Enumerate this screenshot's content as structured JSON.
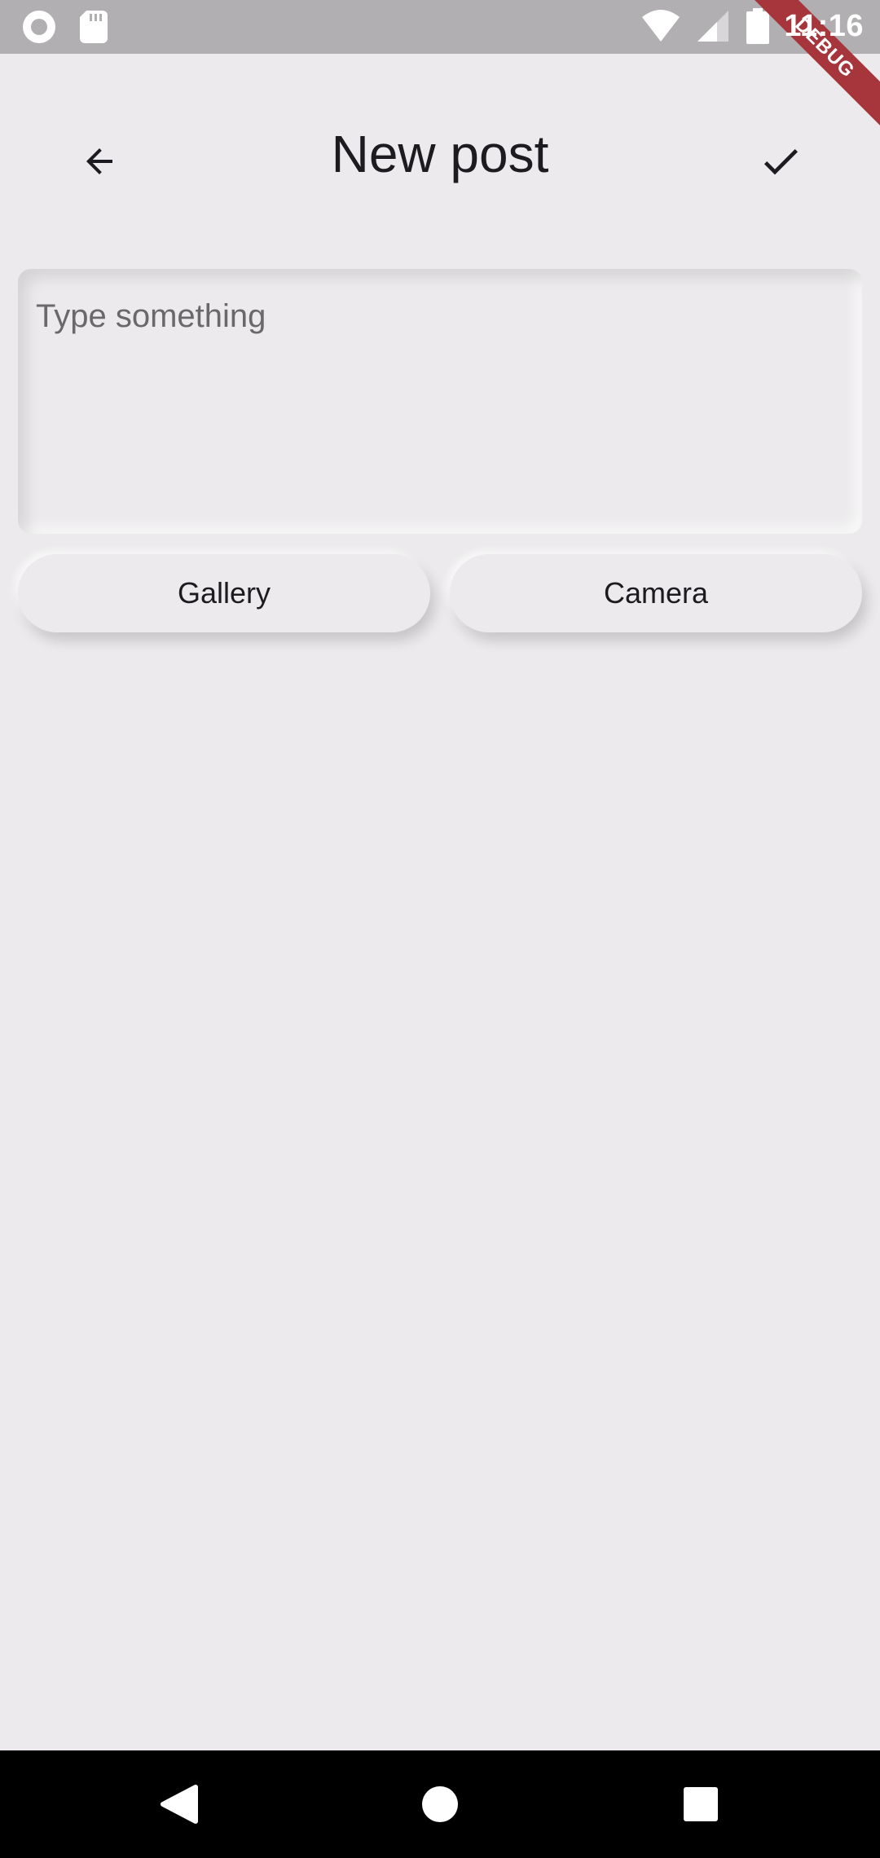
{
  "status_bar": {
    "time": "11:16",
    "icons": [
      "record-icon",
      "sd-card-icon",
      "wifi-icon",
      "signal-icon",
      "battery-icon"
    ],
    "debug_label": "DEBUG"
  },
  "app_bar": {
    "title": "New post",
    "back_icon": "arrow-back-icon",
    "confirm_icon": "check-icon"
  },
  "composer": {
    "placeholder": "Type something",
    "value": ""
  },
  "actions": {
    "gallery_label": "Gallery",
    "camera_label": "Camera"
  },
  "nav_bar": {
    "icons": [
      "nav-back-icon",
      "nav-home-icon",
      "nav-recents-icon"
    ]
  },
  "colors": {
    "background": "#ECEAEC",
    "status_bar": "#B1AFB1",
    "debug_ribbon": "#A6363B",
    "nav_bar": "#000000"
  }
}
